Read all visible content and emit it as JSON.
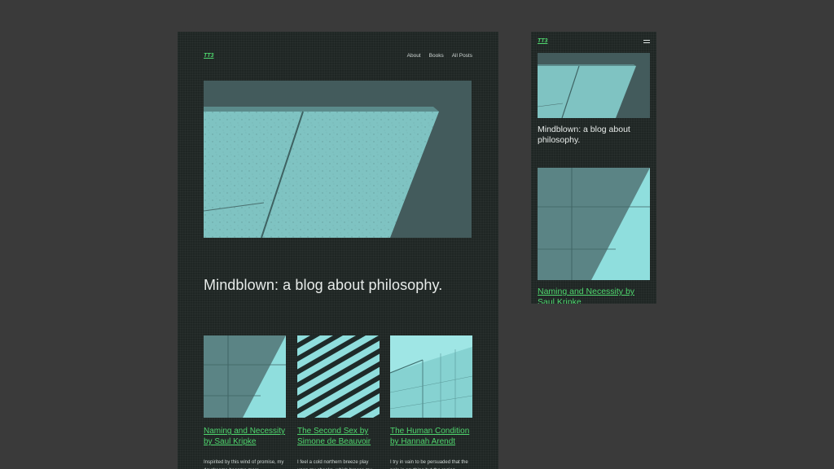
{
  "site": {
    "logo": "TT3",
    "tagline": "Mindblown: a blog about philosophy."
  },
  "nav": {
    "items": [
      {
        "label": "About"
      },
      {
        "label": "Books"
      },
      {
        "label": "All Posts"
      }
    ]
  },
  "posts": [
    {
      "title": "Naming and Necessity by Saul Kripke",
      "excerpt": "Inspirited by this wind of promise, my daydreams become more"
    },
    {
      "title": "The Second Sex by Simone de Beauvoir",
      "excerpt": "I feel a cold northern breeze play upon my cheeks, which braces my"
    },
    {
      "title": "The Human Condition by Hannah Arendt",
      "excerpt": "I try in vain to be persuaded that the pole is anything but the region"
    }
  ],
  "mobile": {
    "menu_icon": "hamburger-icon"
  },
  "colors": {
    "background": "#3a3a3a",
    "page": "#1f2624",
    "accent": "#4fd66e",
    "text": "#e8ecea",
    "image_tint": "#8fd3d2"
  }
}
